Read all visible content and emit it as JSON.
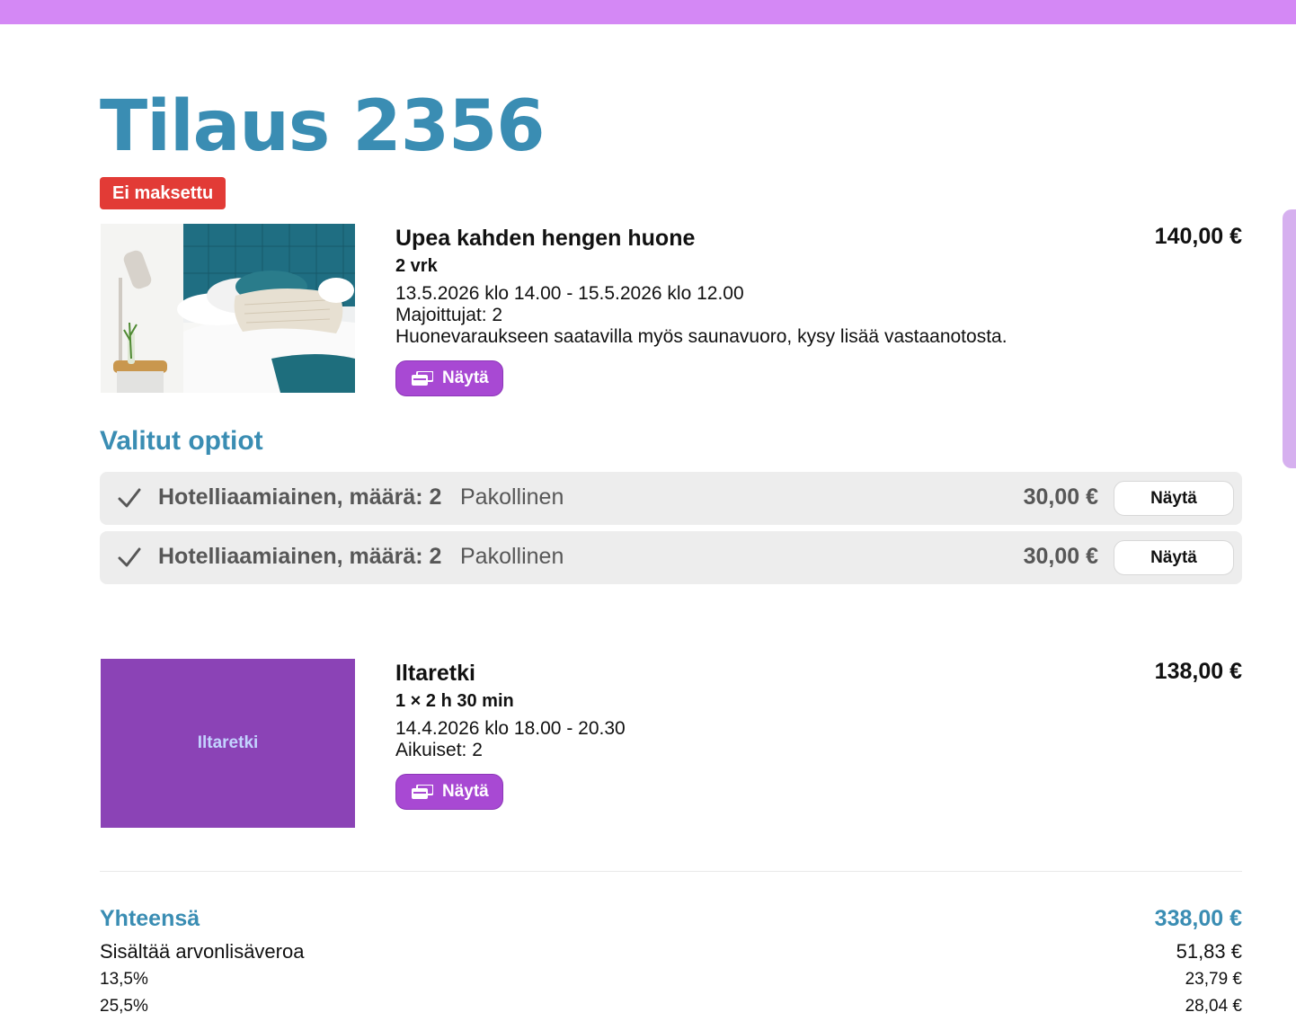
{
  "order": {
    "title": "Tilaus 2356",
    "status": "Ei maksettu"
  },
  "items": [
    {
      "name": "Upea kahden hengen huone",
      "quantity": "2 vrk",
      "dates": "13.5.2026 klo 14.00 - 15.5.2026 klo 12.00",
      "guests": "Majoittujat: 2",
      "description": "Huonevaraukseen saatavilla myös saunavuoro, kysy lisää vastaanotosta.",
      "price": "140,00 €",
      "button_label": "Näytä"
    },
    {
      "name": "Iltaretki",
      "image_label": "Iltaretki",
      "quantity": "1 × 2 h 30 min",
      "dates": "14.4.2026 klo 18.00 - 20.30",
      "guests": "Aikuiset: 2",
      "price": "138,00 €",
      "button_label": "Näytä"
    }
  ],
  "options": {
    "title": "Valitut optiot",
    "rows": [
      {
        "name": "Hotelliaamiainen, määrä: 2",
        "note": "Pakollinen",
        "price": "30,00 €",
        "button_label": "Näytä"
      },
      {
        "name": "Hotelliaamiainen, määrä: 2",
        "note": "Pakollinen",
        "price": "30,00 €",
        "button_label": "Näytä"
      }
    ]
  },
  "totals": {
    "label": "Yhteensä",
    "value": "338,00 €",
    "vat_label": "Sisältää arvonlisäveroa",
    "vat_value": "51,83 €",
    "vat_rates": [
      {
        "rate": "13,5%",
        "amount": "23,79 €"
      },
      {
        "rate": "25,5%",
        "amount": "28,04 €"
      }
    ]
  },
  "icons": {
    "show_button": "card-stack-icon",
    "option_status": "check-icon"
  },
  "colors": {
    "accent": "#3a8db3",
    "brand_purple": "#a849d3",
    "unpaid_badge": "#e23b36",
    "top_bar": "#d488f5"
  }
}
